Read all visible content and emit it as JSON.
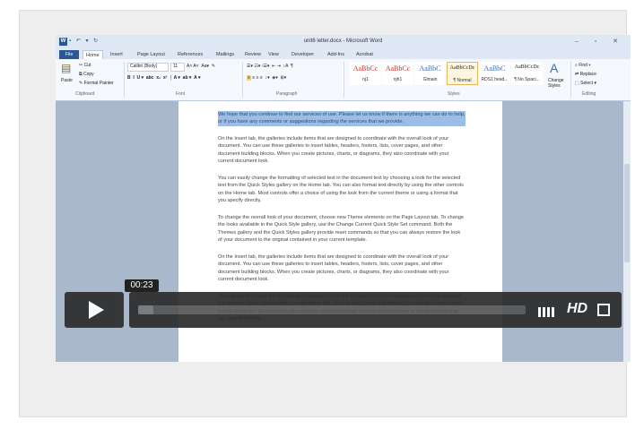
{
  "word": {
    "title": "unit6 letter.docx - Microsoft Word",
    "app_icon": "W",
    "tabs": [
      "File",
      "Home",
      "Insert",
      "Page Layout",
      "References",
      "Mailings",
      "Review",
      "View",
      "Developer",
      "Add-Ins",
      "Acrobat"
    ],
    "clipboard": {
      "paste": "Paste",
      "cut": "Cut",
      "copy": "Copy",
      "format_painter": "Format Painter",
      "label": "Clipboard"
    },
    "font": {
      "name": "Calibri (Body)",
      "size": "11",
      "label": "Font"
    },
    "paragraph": {
      "label": "Paragraph"
    },
    "styles": {
      "label": "Styles",
      "items": [
        {
          "sample": "AaBbCc",
          "name": "nj1"
        },
        {
          "sample": "AaBbCc",
          "name": "njh1"
        },
        {
          "sample": "AaBbC",
          "name": "Glmain"
        },
        {
          "sample": "AaBbCcDc",
          "name": "¶ Normal"
        },
        {
          "sample": "AaBbC",
          "name": "RDS1 head..."
        },
        {
          "sample": "AaBbCcDc",
          "name": "¶ No Spaci..."
        }
      ],
      "change_styles": "Change Styles"
    },
    "editing": {
      "find": "Find",
      "replace": "Replace",
      "select": "Select",
      "label": "Editing"
    },
    "doc_paragraphs": [
      "We hope that you continue to find our services of use. Please let us know if there is anything we can do to help, or if you have any comments or suggestions regarding the services that we provide.",
      "On the Insert tab, the galleries include items that are designed to coordinate with the overall look of your document. You can use these galleries to insert tables, headers, footers, lists, cover pages, and other document building blocks. When you create pictures, charts, or diagrams, they also coordinate with your current document look.",
      "You can easily change the formatting of selected text in the document text by choosing a look for the selected text from the Quick Styles gallery on the Home tab. You can also format text directly by using the other controls on the Home tab. Most controls offer a choice of using the look from the current theme or using a format that you specify directly.",
      "To change the overall look of your document, choose new Theme elements on the Page Layout tab. To change the looks available in the Quick Style gallery, use the Change Current Quick Style Set command. Both the Themes gallery and the Quick Styles gallery provide reset commands so that you can always restore the look of your document to the original contained in your current template.",
      "On the Insert tab, the galleries include items that are designed to coordinate with the overall look of your document. You can use these galleries to insert tables, headers, footers, lists, cover pages, and other document building blocks. When you create pictures, charts, or diagrams, they also coordinate with your current document look.",
      "You can easily change the formatting of selected text in the document text by choosing a look for the selected text from the Quick Styles gallery on the Home tab. You can also format text directly by using the other controls on the Home tab. Most controls offer a choice of using the look from the current theme or using a format that you specify directly."
    ]
  },
  "player": {
    "time": "00:23",
    "hd_label": "HD",
    "progress": 0.04,
    "icons": {
      "play": "play-icon",
      "volume": "volume-icon",
      "fullscreen": "fullscreen-icon"
    }
  }
}
